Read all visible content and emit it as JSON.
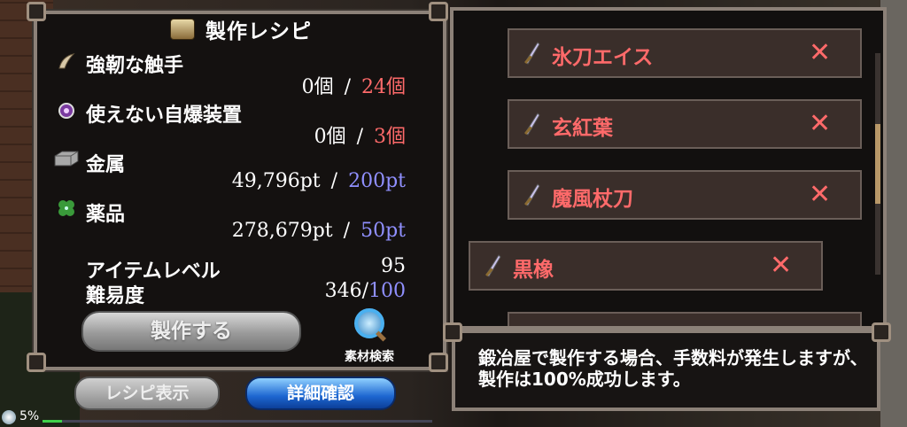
{
  "recipe": {
    "title": "製作レシピ",
    "materials": [
      {
        "name": "強靭な触手",
        "have": "0個",
        "need": "24個",
        "icon": "horn-icon",
        "need_color": "#ff6a6a"
      },
      {
        "name": "使えない自爆装置",
        "have": "0個",
        "need": "3個",
        "icon": "orb-icon",
        "need_color": "#ff6a6a"
      },
      {
        "name": "金属",
        "have": "49,796pt",
        "need": "200pt",
        "icon": "metal-ingot-icon",
        "need_color": "#9090ff"
      },
      {
        "name": "薬品",
        "have": "278,679pt",
        "need": "50pt",
        "icon": "clover-icon",
        "need_color": "#9090ff"
      }
    ],
    "separator": "/",
    "item_level_label": "アイテムレベル",
    "item_level_value": "95",
    "difficulty_label": "難易度",
    "difficulty_value": "346/",
    "difficulty_max": "100",
    "craft_button": "製作する",
    "search_label": "素材検索"
  },
  "buttons": {
    "recipe_display": "レシピ表示",
    "detail_confirm": "詳細確認"
  },
  "status": {
    "percent": "5%",
    "progress": 0.05
  },
  "list": {
    "items": [
      {
        "name": "氷刀エイス",
        "icon": "sword-icon",
        "remove": "✕"
      },
      {
        "name": "玄紅葉",
        "icon": "sword-icon",
        "remove": "✕"
      },
      {
        "name": "魔風杖刀",
        "icon": "sword-icon",
        "remove": "✕"
      },
      {
        "name": "黒橡",
        "icon": "sword-icon",
        "remove": "✕"
      }
    ]
  },
  "message": "鍛冶屋で製作する場合、手数料が発生しますが、製作は100%成功します。",
  "colors": {
    "insufficient": "#ff6a6a",
    "sufficient": "#9090ff",
    "accent": "#1d66d0"
  }
}
